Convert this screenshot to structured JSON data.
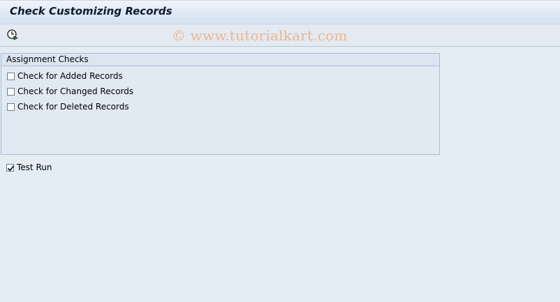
{
  "window": {
    "title": "Check Customizing Records"
  },
  "toolbar": {
    "execute_icon": "execute-clock-icon",
    "watermark": "© www.tutorialkart.com"
  },
  "group": {
    "title": "Assignment Checks",
    "items": [
      {
        "label": "Check for Added Records",
        "checked": false
      },
      {
        "label": "Check for Changed Records",
        "checked": false
      },
      {
        "label": "Check for Deleted Records",
        "checked": false
      }
    ]
  },
  "test_run": {
    "label": "Test Run",
    "checked": true
  }
}
